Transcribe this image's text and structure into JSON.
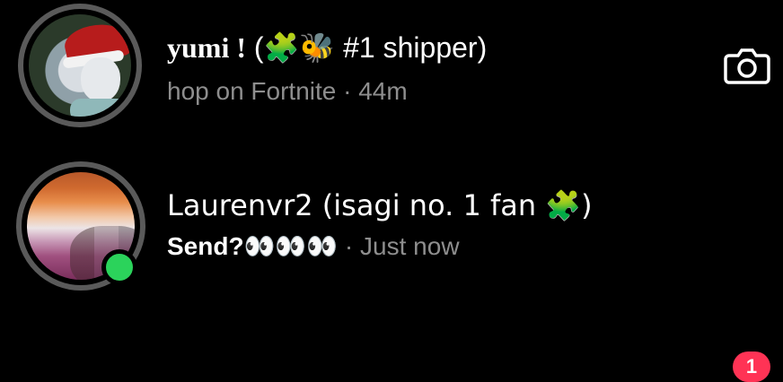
{
  "threads": [
    {
      "name": "yumi !",
      "name_rest": " (🧩🐝 #1 shipper)",
      "subtitle": "hop on Fortnite",
      "separator": " · ",
      "time": "44m",
      "action_icon": "camera-icon"
    },
    {
      "name": "Laurenvr2 (isagi no. 1 fan 🧩)",
      "message": "Send?",
      "message_emoji": "👀👀👀",
      "separator": " · ",
      "time": "Just now",
      "unread_count": "1",
      "online": true
    }
  ],
  "colors": {
    "background": "#000000",
    "secondary_text": "#8e8e8e",
    "badge": "#ff3355",
    "online": "#2bd35b",
    "ring": "#5a5a5a"
  }
}
